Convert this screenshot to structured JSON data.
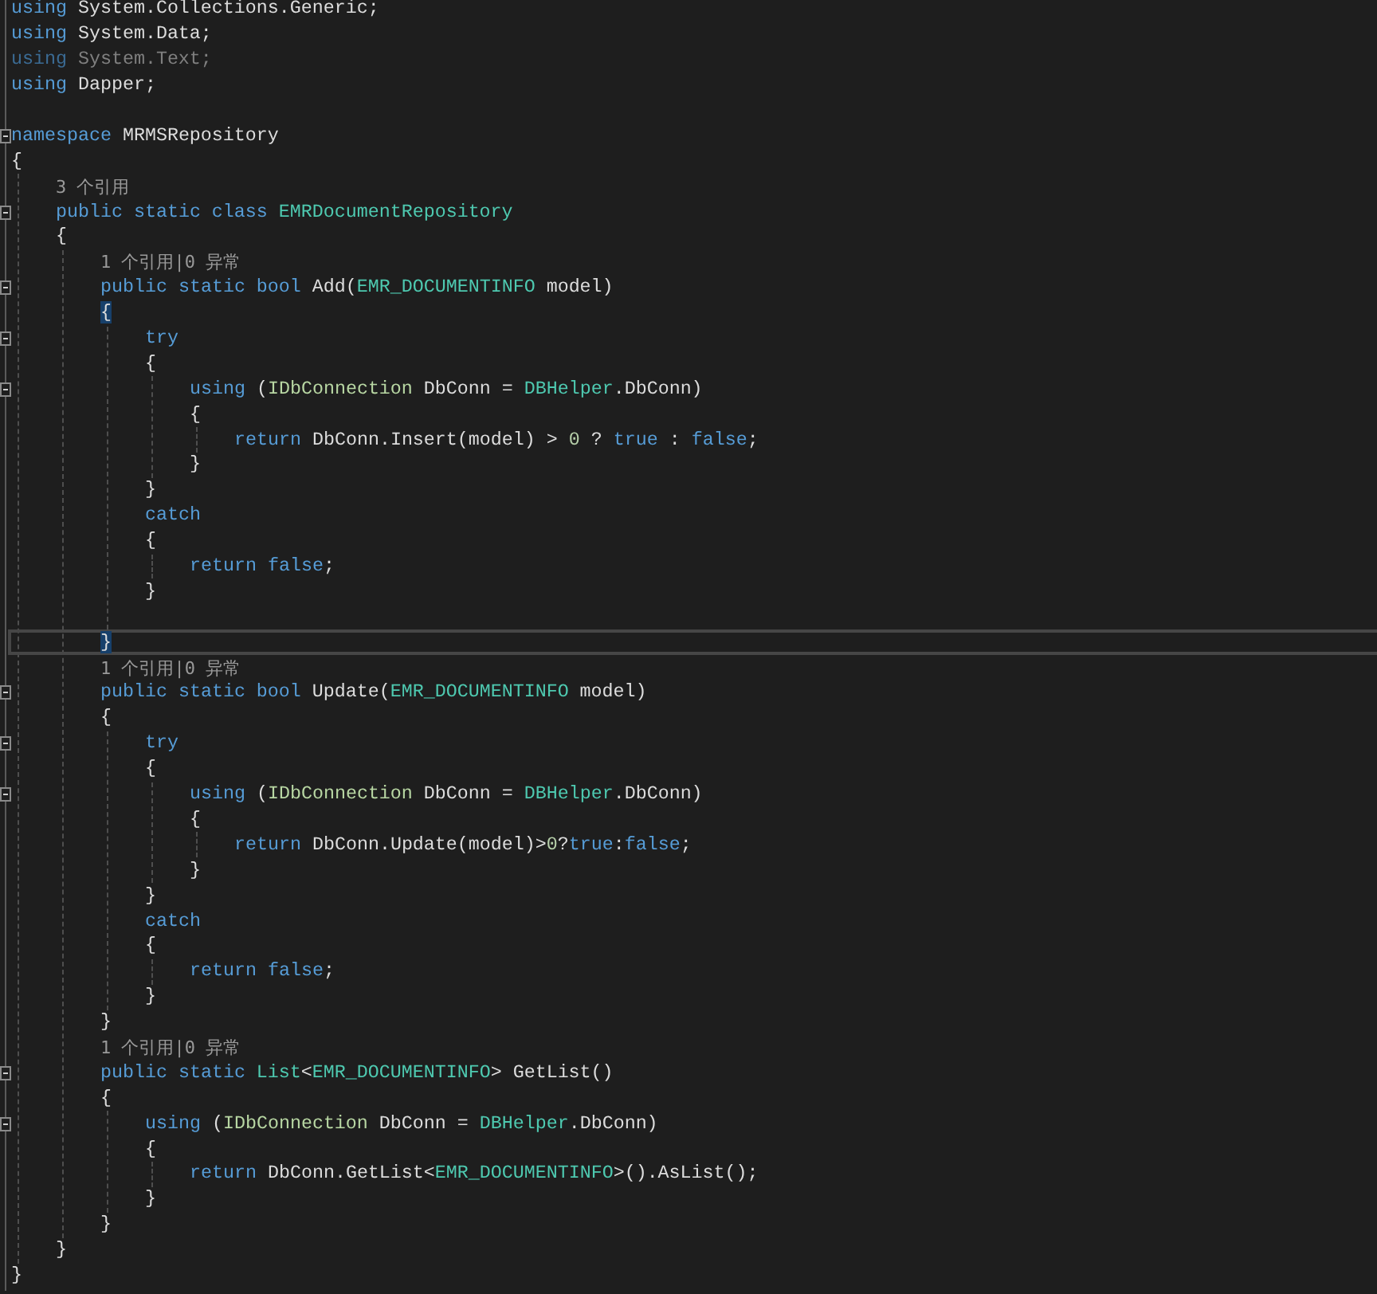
{
  "lines": [
    {
      "kind": "code",
      "tokens": [
        {
          "kind": "kw",
          "text": "using"
        },
        {
          "kind": "text",
          "text": " System.Collections.Generic;"
        }
      ]
    },
    {
      "kind": "code",
      "tokens": [
        {
          "kind": "kw",
          "text": "using"
        },
        {
          "kind": "text",
          "text": " System.Data;"
        }
      ]
    },
    {
      "kind": "code",
      "tokens": [
        {
          "kind": "dim-kw",
          "text": "using"
        },
        {
          "kind": "dim-text",
          "text": " System.Text;"
        }
      ]
    },
    {
      "kind": "code",
      "tokens": [
        {
          "kind": "kw",
          "text": "using"
        },
        {
          "kind": "text",
          "text": " Dapper;"
        }
      ]
    },
    {
      "kind": "blank"
    },
    {
      "kind": "code",
      "expanded": true,
      "tokens": [
        {
          "kind": "kw",
          "text": "namespace"
        },
        {
          "kind": "text",
          "text": " MRMSRepository"
        }
      ]
    },
    {
      "kind": "code",
      "tokens": [
        {
          "kind": "text",
          "text": "{"
        }
      ],
      "children": [
        {
          "kind": "lens",
          "text": "3 个引用"
        },
        {
          "kind": "code",
          "expanded": true,
          "tokens": [
            {
              "kind": "kw",
              "text": "public static class"
            },
            {
              "kind": "type",
              "text": " EMRDocumentRepository"
            }
          ]
        },
        {
          "kind": "code",
          "tokens": [
            {
              "kind": "text",
              "text": "{"
            }
          ],
          "children": [
            {
              "kind": "lens",
              "text": "1 个引用|0 异常"
            },
            {
              "kind": "code",
              "expanded": true,
              "tokens": [
                {
                  "kind": "kw",
                  "text": "public static bool"
                },
                {
                  "kind": "text",
                  "text": " Add("
                },
                {
                  "kind": "type",
                  "text": "EMR_DOCUMENTINFO"
                },
                {
                  "kind": "text",
                  "text": " model)"
                }
              ]
            },
            {
              "kind": "code",
              "tokens": [
                {
                  "kind": "brace",
                  "text": "{"
                }
              ],
              "children": [
                {
                  "kind": "code",
                  "expanded": true,
                  "tokens": [
                    {
                      "kind": "kw",
                      "text": "try"
                    }
                  ]
                },
                {
                  "kind": "code",
                  "tokens": [
                    {
                      "kind": "text",
                      "text": "{"
                    }
                  ],
                  "children": [
                    {
                      "kind": "code",
                      "expanded": true,
                      "tokens": [
                        {
                          "kind": "kw",
                          "text": "using"
                        },
                        {
                          "kind": "text",
                          "text": " ("
                        },
                        {
                          "kind": "iface",
                          "text": "IDbConnection"
                        },
                        {
                          "kind": "text",
                          "text": " DbConn = "
                        },
                        {
                          "kind": "type",
                          "text": "DBHelper"
                        },
                        {
                          "kind": "text",
                          "text": ".DbConn)"
                        }
                      ]
                    },
                    {
                      "kind": "code",
                      "tokens": [
                        {
                          "kind": "text",
                          "text": "{"
                        }
                      ],
                      "children": [
                        {
                          "kind": "code",
                          "tokens": [
                            {
                              "kind": "kw",
                              "text": "return"
                            },
                            {
                              "kind": "text",
                              "text": " DbConn.Insert(model) > "
                            },
                            {
                              "kind": "num",
                              "text": "0"
                            },
                            {
                              "kind": "text",
                              "text": " ? "
                            },
                            {
                              "kind": "kw",
                              "text": "true"
                            },
                            {
                              "kind": "text",
                              "text": " : "
                            },
                            {
                              "kind": "kw",
                              "text": "false"
                            },
                            {
                              "kind": "text",
                              "text": ";"
                            }
                          ]
                        }
                      ]
                    },
                    {
                      "kind": "code",
                      "tokens": [
                        {
                          "kind": "text",
                          "text": "}"
                        }
                      ]
                    }
                  ]
                },
                {
                  "kind": "code",
                  "tokens": [
                    {
                      "kind": "text",
                      "text": "}"
                    }
                  ]
                },
                {
                  "kind": "code",
                  "tokens": [
                    {
                      "kind": "kw",
                      "text": "catch"
                    }
                  ]
                },
                {
                  "kind": "code",
                  "tokens": [
                    {
                      "kind": "text",
                      "text": "{"
                    }
                  ],
                  "children": [
                    {
                      "kind": "code",
                      "tokens": [
                        {
                          "kind": "kw",
                          "text": "return false"
                        },
                        {
                          "kind": "text",
                          "text": ";"
                        }
                      ]
                    }
                  ]
                },
                {
                  "kind": "code",
                  "tokens": [
                    {
                      "kind": "text",
                      "text": "}"
                    }
                  ]
                },
                {
                  "kind": "blank"
                }
              ]
            },
            {
              "kind": "current",
              "tokens": [
                {
                  "kind": "brace",
                  "text": "}"
                }
              ]
            },
            {
              "kind": "lens",
              "text": "1 个引用|0 异常"
            },
            {
              "kind": "code",
              "expanded": true,
              "tokens": [
                {
                  "kind": "kw",
                  "text": "public static bool"
                },
                {
                  "kind": "text",
                  "text": " Update("
                },
                {
                  "kind": "type",
                  "text": "EMR_DOCUMENTINFO"
                },
                {
                  "kind": "text",
                  "text": " model)"
                }
              ]
            },
            {
              "kind": "code",
              "tokens": [
                {
                  "kind": "text",
                  "text": "{"
                }
              ],
              "children": [
                {
                  "kind": "code",
                  "expanded": true,
                  "tokens": [
                    {
                      "kind": "kw",
                      "text": "try"
                    }
                  ]
                },
                {
                  "kind": "code",
                  "tokens": [
                    {
                      "kind": "text",
                      "text": "{"
                    }
                  ],
                  "children": [
                    {
                      "kind": "code",
                      "expanded": true,
                      "tokens": [
                        {
                          "kind": "kw",
                          "text": "using"
                        },
                        {
                          "kind": "text",
                          "text": " ("
                        },
                        {
                          "kind": "iface",
                          "text": "IDbConnection"
                        },
                        {
                          "kind": "text",
                          "text": " DbConn = "
                        },
                        {
                          "kind": "type",
                          "text": "DBHelper"
                        },
                        {
                          "kind": "text",
                          "text": ".DbConn)"
                        }
                      ]
                    },
                    {
                      "kind": "code",
                      "tokens": [
                        {
                          "kind": "text",
                          "text": "{"
                        }
                      ],
                      "children": [
                        {
                          "kind": "code",
                          "tokens": [
                            {
                              "kind": "kw",
                              "text": "return"
                            },
                            {
                              "kind": "text",
                              "text": " DbConn.Update(model)>"
                            },
                            {
                              "kind": "num",
                              "text": "0"
                            },
                            {
                              "kind": "text",
                              "text": "?"
                            },
                            {
                              "kind": "kw",
                              "text": "true"
                            },
                            {
                              "kind": "text",
                              "text": ":"
                            },
                            {
                              "kind": "kw",
                              "text": "false"
                            },
                            {
                              "kind": "text",
                              "text": ";"
                            }
                          ]
                        }
                      ]
                    },
                    {
                      "kind": "code",
                      "tokens": [
                        {
                          "kind": "text",
                          "text": "}"
                        }
                      ]
                    }
                  ]
                },
                {
                  "kind": "code",
                  "tokens": [
                    {
                      "kind": "text",
                      "text": "}"
                    }
                  ]
                },
                {
                  "kind": "code",
                  "tokens": [
                    {
                      "kind": "kw",
                      "text": "catch"
                    }
                  ]
                },
                {
                  "kind": "code",
                  "tokens": [
                    {
                      "kind": "text",
                      "text": "{"
                    }
                  ],
                  "children": [
                    {
                      "kind": "code",
                      "tokens": [
                        {
                          "kind": "kw",
                          "text": "return false"
                        },
                        {
                          "kind": "text",
                          "text": ";"
                        }
                      ]
                    }
                  ]
                },
                {
                  "kind": "code",
                  "tokens": [
                    {
                      "kind": "text",
                      "text": "}"
                    }
                  ]
                }
              ]
            },
            {
              "kind": "code",
              "tokens": [
                {
                  "kind": "text",
                  "text": "}"
                }
              ]
            },
            {
              "kind": "lens",
              "text": "1 个引用|0 异常"
            },
            {
              "kind": "code",
              "expanded": true,
              "tokens": [
                {
                  "kind": "kw",
                  "text": "public static"
                },
                {
                  "kind": "type",
                  "text": " List"
                },
                {
                  "kind": "text",
                  "text": "<"
                },
                {
                  "kind": "type",
                  "text": "EMR_DOCUMENTINFO"
                },
                {
                  "kind": "text",
                  "text": "> GetList()"
                }
              ]
            },
            {
              "kind": "code",
              "tokens": [
                {
                  "kind": "text",
                  "text": "{"
                }
              ],
              "children": [
                {
                  "kind": "code",
                  "expanded": true,
                  "tokens": [
                    {
                      "kind": "kw",
                      "text": "using"
                    },
                    {
                      "kind": "text",
                      "text": " ("
                    },
                    {
                      "kind": "iface",
                      "text": "IDbConnection"
                    },
                    {
                      "kind": "text",
                      "text": " DbConn = "
                    },
                    {
                      "kind": "type",
                      "text": "DBHelper"
                    },
                    {
                      "kind": "text",
                      "text": ".DbConn)"
                    }
                  ]
                },
                {
                  "kind": "code",
                  "tokens": [
                    {
                      "kind": "text",
                      "text": "{"
                    }
                  ],
                  "children": [
                    {
                      "kind": "code",
                      "tokens": [
                        {
                          "kind": "kw",
                          "text": "return"
                        },
                        {
                          "kind": "text",
                          "text": " DbConn.GetList<"
                        },
                        {
                          "kind": "type",
                          "text": "EMR_DOCUMENTINFO"
                        },
                        {
                          "kind": "text",
                          "text": ">().AsList();"
                        }
                      ]
                    }
                  ]
                },
                {
                  "kind": "code",
                  "tokens": [
                    {
                      "kind": "text",
                      "text": "}"
                    }
                  ]
                }
              ]
            },
            {
              "kind": "code",
              "tokens": [
                {
                  "kind": "text",
                  "text": "}"
                }
              ]
            }
          ]
        },
        {
          "kind": "code",
          "tokens": [
            {
              "kind": "text",
              "text": "}"
            }
          ]
        }
      ]
    },
    {
      "kind": "code",
      "tokens": [
        {
          "kind": "text",
          "text": "}"
        }
      ]
    }
  ]
}
